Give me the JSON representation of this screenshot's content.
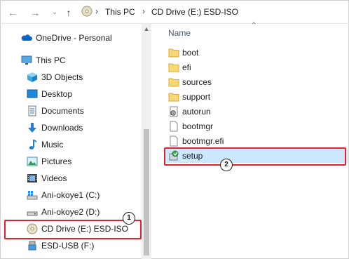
{
  "breadcrumb": {
    "this_pc": "This PC",
    "drive": "CD Drive (E:) ESD-ISO"
  },
  "sidebar": {
    "items": [
      {
        "label": "OneDrive - Personal",
        "icon": "cloud-icon"
      },
      {
        "label": "This PC",
        "icon": "monitor-icon"
      },
      {
        "label": "3D Objects",
        "icon": "cube-icon"
      },
      {
        "label": "Desktop",
        "icon": "desktop-icon"
      },
      {
        "label": "Documents",
        "icon": "document-icon"
      },
      {
        "label": "Downloads",
        "icon": "download-arrow-icon"
      },
      {
        "label": "Music",
        "icon": "music-note-icon"
      },
      {
        "label": "Pictures",
        "icon": "picture-icon"
      },
      {
        "label": "Videos",
        "icon": "film-icon"
      },
      {
        "label": "Ani-okoye1 (C:)",
        "icon": "windows-drive-icon"
      },
      {
        "label": "Ani-okoye2 (D:)",
        "icon": "drive-icon"
      },
      {
        "label": "CD Drive (E:) ESD-ISO",
        "icon": "cd-drive-icon"
      },
      {
        "label": "ESD-USB (F:)",
        "icon": "usb-drive-icon"
      }
    ]
  },
  "content": {
    "column_header": "Name",
    "files": [
      {
        "label": "boot",
        "icon": "folder-icon"
      },
      {
        "label": "efi",
        "icon": "folder-icon"
      },
      {
        "label": "sources",
        "icon": "folder-icon"
      },
      {
        "label": "support",
        "icon": "folder-icon"
      },
      {
        "label": "autorun",
        "icon": "settings-file-icon"
      },
      {
        "label": "bootmgr",
        "icon": "file-icon"
      },
      {
        "label": "bootmgr.efi",
        "icon": "file-icon"
      },
      {
        "label": "setup",
        "icon": "setup-icon"
      }
    ]
  },
  "annotations": {
    "badge1": "1",
    "badge2": "2",
    "highlight_color": "#e5202a",
    "selection_color": "#cce8ff"
  }
}
